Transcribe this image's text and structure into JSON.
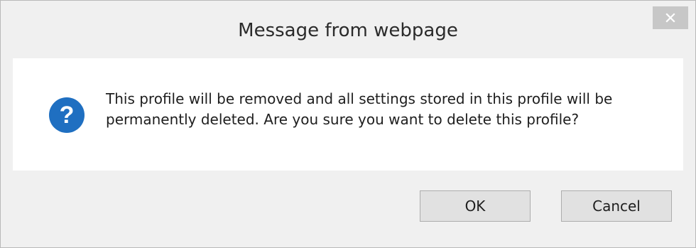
{
  "dialog": {
    "title": "Message from webpage",
    "close_icon": "close-icon",
    "icon": "question-icon",
    "message": "This profile will be removed and all settings stored in this profile will be permanently deleted. Are you sure you want to delete this profile?",
    "buttons": {
      "ok_label": "OK",
      "cancel_label": "Cancel"
    }
  },
  "colors": {
    "question_icon_bg": "#1f6fc1",
    "dialog_bg": "#f0f0f0",
    "content_bg": "#ffffff",
    "close_button_bg": "#c7c7c7"
  }
}
